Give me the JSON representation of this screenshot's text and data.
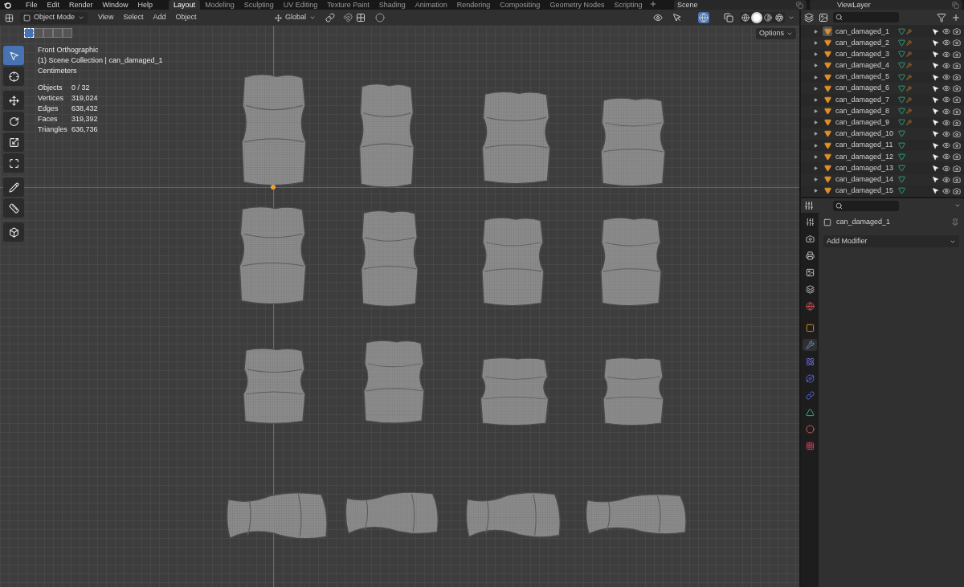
{
  "menu": [
    "File",
    "Edit",
    "Render",
    "Window",
    "Help"
  ],
  "workspaces": [
    {
      "label": "Layout",
      "selected": true
    },
    {
      "label": "Modeling",
      "selected": false
    },
    {
      "label": "Sculpting",
      "selected": false
    },
    {
      "label": "UV Editing",
      "selected": false
    },
    {
      "label": "Texture Paint",
      "selected": false
    },
    {
      "label": "Shading",
      "selected": false
    },
    {
      "label": "Animation",
      "selected": false
    },
    {
      "label": "Rendering",
      "selected": false
    },
    {
      "label": "Compositing",
      "selected": false
    },
    {
      "label": "Geometry Nodes",
      "selected": false
    },
    {
      "label": "Scripting",
      "selected": false
    }
  ],
  "scene": "Scene",
  "view_layer": "ViewLayer",
  "header": {
    "mode": "Object Mode",
    "menus": [
      "View",
      "Select",
      "Add",
      "Object"
    ],
    "orientation": "Global",
    "options": "Options"
  },
  "shading": [
    {
      "kind": "wireframe",
      "selected": false
    },
    {
      "kind": "solid",
      "selected": true
    },
    {
      "kind": "material",
      "selected": false
    },
    {
      "kind": "rendered",
      "selected": false
    }
  ],
  "select_modes": [
    {
      "selected": true
    },
    {
      "selected": false
    },
    {
      "selected": false
    },
    {
      "selected": false
    },
    {
      "selected": false
    }
  ],
  "tools": [
    {
      "kind": "select",
      "selected": true
    },
    {
      "kind": "cursor",
      "selected": false
    },
    {
      "kind": "move",
      "selected": false
    },
    {
      "kind": "rotate",
      "selected": false
    },
    {
      "kind": "scale",
      "selected": false
    },
    {
      "kind": "transform",
      "selected": false
    },
    {
      "kind": "annotate",
      "selected": false
    },
    {
      "kind": "measure",
      "selected": false
    },
    {
      "kind": "add-cube",
      "selected": false
    }
  ],
  "overlay": {
    "view": "Front Orthographic",
    "collection": "(1) Scene Collection | can_damaged_1",
    "units": "Centimeters",
    "stats": [
      {
        "label": "Objects",
        "value": "0 / 32"
      },
      {
        "label": "Vertices",
        "value": "319,024"
      },
      {
        "label": "Edges",
        "value": "638,432"
      },
      {
        "label": "Faces",
        "value": "319,392"
      },
      {
        "label": "Triangles",
        "value": "636,736"
      }
    ]
  },
  "outliner": {
    "items": [
      {
        "name": "can_damaged_1",
        "selected": true,
        "modifier": true
      },
      {
        "name": "can_damaged_2",
        "selected": false,
        "modifier": true
      },
      {
        "name": "can_damaged_3",
        "selected": false,
        "modifier": true
      },
      {
        "name": "can_damaged_4",
        "selected": false,
        "modifier": true
      },
      {
        "name": "can_damaged_5",
        "selected": false,
        "modifier": true
      },
      {
        "name": "can_damaged_6",
        "selected": false,
        "modifier": true
      },
      {
        "name": "can_damaged_7",
        "selected": false,
        "modifier": true
      },
      {
        "name": "can_damaged_8",
        "selected": false,
        "modifier": true
      },
      {
        "name": "can_damaged_9",
        "selected": false,
        "modifier": true
      },
      {
        "name": "can_damaged_10",
        "selected": false,
        "modifier": false
      },
      {
        "name": "can_damaged_11",
        "selected": false,
        "modifier": false
      },
      {
        "name": "can_damaged_12",
        "selected": false,
        "modifier": false
      },
      {
        "name": "can_damaged_13",
        "selected": false,
        "modifier": false
      },
      {
        "name": "can_damaged_14",
        "selected": false,
        "modifier": false
      },
      {
        "name": "can_damaged_15",
        "selected": false,
        "modifier": false
      }
    ]
  },
  "properties": {
    "object": "can_damaged_1",
    "add_modifier": "Add Modifier",
    "tabs": [
      {
        "kind": "tool",
        "selected": false
      },
      {
        "kind": "render",
        "selected": false
      },
      {
        "kind": "output",
        "selected": false
      },
      {
        "kind": "view-layer",
        "selected": false
      },
      {
        "kind": "scene",
        "selected": false
      },
      {
        "kind": "world",
        "selected": false
      },
      {
        "kind": "object",
        "selected": false
      },
      {
        "kind": "modifier",
        "selected": true
      },
      {
        "kind": "particles",
        "selected": false
      },
      {
        "kind": "physics",
        "selected": false
      },
      {
        "kind": "constraints",
        "selected": false
      },
      {
        "kind": "data",
        "selected": false
      },
      {
        "kind": "material",
        "selected": false
      },
      {
        "kind": "texture",
        "selected": false
      }
    ]
  }
}
